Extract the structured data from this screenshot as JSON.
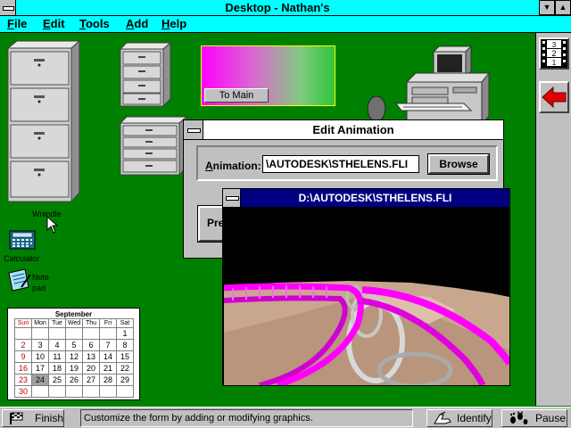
{
  "window": {
    "title": "Desktop - Nathan's"
  },
  "menu": [
    {
      "label": "File",
      "accel": "F",
      "rest": "ile"
    },
    {
      "label": "Edit",
      "accel": "E",
      "rest": "dit"
    },
    {
      "label": "Tools",
      "accel": "T",
      "rest": "ools"
    },
    {
      "label": "Add",
      "accel": "A",
      "rest": "dd"
    },
    {
      "label": "Help",
      "accel": "H",
      "rest": "elp"
    }
  ],
  "gradient_panel": {
    "button_label": "To Main"
  },
  "desktop_icons": {
    "cabinet_label": "Wnindle",
    "calculator_label": "Calculator",
    "notepad_label_line1": "Note",
    "notepad_label_line2": "pad"
  },
  "edit_dialog": {
    "title": "Edit Animation",
    "animation_label": "Animation:",
    "animation_accel": "A",
    "animation_rest": "nimation:",
    "path_value": "\\AUTODESK\\STHELENS.FLI",
    "browse_label": "Browse",
    "preview_partial": "Pre"
  },
  "flic_window": {
    "title": "D:\\AUTODESK\\STHELENS.FLI"
  },
  "calendar": {
    "month": "September",
    "day_names": [
      "Sun",
      "Mon",
      "Tue",
      "Wed",
      "Thu",
      "Fri",
      "Sat"
    ],
    "weeks": [
      [
        "",
        "",
        "",
        "",
        "",
        "",
        "1"
      ],
      [
        "2",
        "3",
        "4",
        "5",
        "6",
        "7",
        "8"
      ],
      [
        "9",
        "10",
        "11",
        "12",
        "13",
        "14",
        "15"
      ],
      [
        "16",
        "17",
        "18",
        "19",
        "20",
        "21",
        "22"
      ],
      [
        "23",
        "24",
        "25",
        "26",
        "27",
        "28",
        "29"
      ],
      [
        "30",
        "",
        "",
        "",
        "",
        "",
        ""
      ]
    ],
    "highlighted_day": "24"
  },
  "right_toolbar": {
    "film_numbers": [
      "3",
      "2",
      "1"
    ]
  },
  "status_bar": {
    "finish_label": "Finish",
    "status_text": "Customize the form by adding or modifying graphics.",
    "identify_label": "Identify",
    "pause_label": "Pause"
  },
  "colors": {
    "desktop": "#008000",
    "titlebar": "#00ffff",
    "flic_titlebar": "#000080",
    "track": "#ff00ff",
    "arrow": "#e00000"
  }
}
